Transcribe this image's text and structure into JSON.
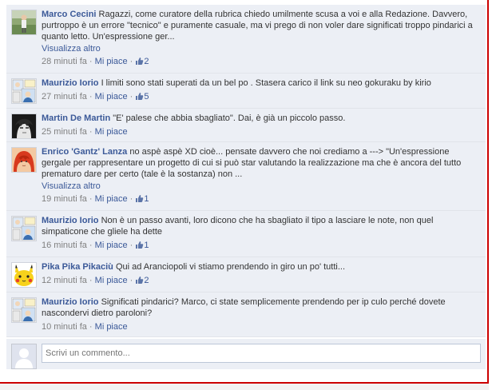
{
  "ui": {
    "see_more": "Visualizza altro",
    "like_label": "Mi piace",
    "separator": " · ",
    "write_placeholder": "Scrivi un commento..."
  },
  "comments": [
    {
      "author": "Marco Cecini",
      "text": "Ragazzi, come curatore della rubrica chiedo umilmente scusa a voi e alla Redazione. Davvero, purtroppo è un errore \"tecnico\" e puramente casuale, ma vi prego di non voler dare significati troppo pindarici a quanto letto. Un'espressione ger...",
      "see_more": true,
      "time": "28 minuti fa",
      "likes": "2",
      "avatar": "photo-person-outdoors"
    },
    {
      "author": "Maurizio Iorio",
      "text": "I limiti sono stati superati da un bel po . Stasera carico il link su neo gokuraku by kirio",
      "see_more": false,
      "time": "27 minuti fa",
      "likes": "5",
      "avatar": "manga-panel"
    },
    {
      "author": "Martin De Martin",
      "text": "\"E' palese che abbia sbagliato\". Dai, è già un piccolo passo.",
      "see_more": false,
      "time": "25 minuti fa",
      "likes": "",
      "avatar": "bw-anime-face"
    },
    {
      "author": "Enrico 'Gantz' Lanza",
      "text": "no aspè aspè XD cioè... pensate davvero che noi crediamo a ---> \"Un'espressione gergale per rappresentare un progetto di cui si può star valutando la realizzazione ma che è ancora del tutto prematuro dare per certo (tale è la sostanza) non ...",
      "see_more": true,
      "time": "19 minuti fa",
      "likes": "1",
      "avatar": "red-hair-anime"
    },
    {
      "author": "Maurizio Iorio",
      "text": "Non è un passo avanti, loro dicono che ha sbagliato il tipo a lasciare le note, non quel simpaticone che gliele ha dette",
      "see_more": false,
      "time": "16 minuti fa",
      "likes": "1",
      "avatar": "manga-panel"
    },
    {
      "author": "Pika Pika Pikaciù",
      "text": "Qui ad Aranciopoli vi stiamo prendendo in giro un po' tutti...",
      "see_more": false,
      "time": "12 minuti fa",
      "likes": "2",
      "avatar": "pikachu"
    },
    {
      "author": "Maurizio Iorio",
      "text": "Significati pindarici? Marco, ci state semplicemente prendendo per ip culo perché dovete nascondervi dietro paroloni?",
      "see_more": false,
      "time": "10 minuti fa",
      "likes": "",
      "avatar": "manga-panel"
    }
  ],
  "colors": {
    "link": "#3b5998",
    "comment_bg": "#eceff5",
    "meta_gray": "#808080",
    "frame_red": "#cc0000"
  }
}
